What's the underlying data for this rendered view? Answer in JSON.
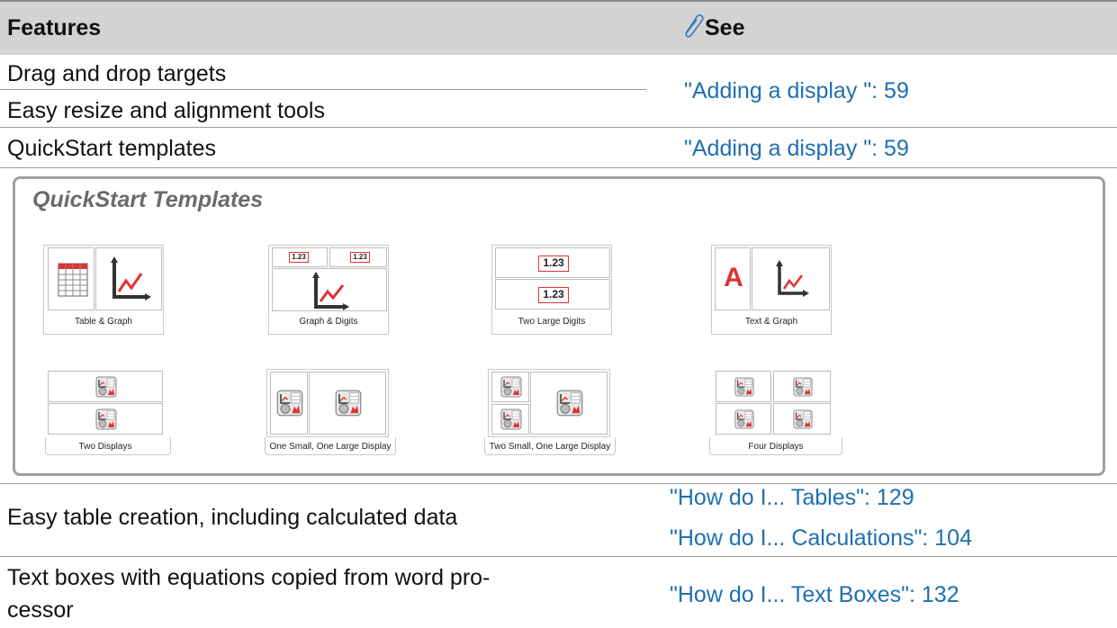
{
  "header": {
    "features": "Features",
    "see": "See"
  },
  "rows": [
    {
      "feature": "Drag and drop targets"
    },
    {
      "feature": "Easy resize and alignment tools"
    },
    {
      "feature": "QuickStart templates"
    }
  ],
  "links": {
    "adding_display_1": "\"Adding a display \":  59",
    "adding_display_2": "\"Adding a display \":  59",
    "tables": "\"How do I... Tables\":  129",
    "calculations": "\"How do I... Calculations\":  104",
    "text_boxes": "\"How do I... Text Boxes\":  132"
  },
  "panel": {
    "title": "QuickStart Templates",
    "templates": [
      {
        "label": "Table & Graph"
      },
      {
        "label": "Graph & Digits",
        "digit": "1.23"
      },
      {
        "label": "Two Large Digits",
        "digit": "1.23"
      },
      {
        "label": "Text & Graph",
        "letter": "A"
      },
      {
        "label": "Two Displays"
      },
      {
        "label": "One Small, One Large Display"
      },
      {
        "label": "Two Small, One Large Display"
      },
      {
        "label": "Four Displays"
      }
    ]
  },
  "rows_bottom": [
    {
      "feature": "Easy table creation, including calculated data"
    },
    {
      "feature_line1": "Text boxes with equations copied from word pro-",
      "feature_line2": "cessor"
    }
  ],
  "colors": {
    "header_bg": "#d3d3d3",
    "link": "#1f6fb2",
    "accent_red": "#d33333",
    "panel_border": "#a0a0a0"
  }
}
